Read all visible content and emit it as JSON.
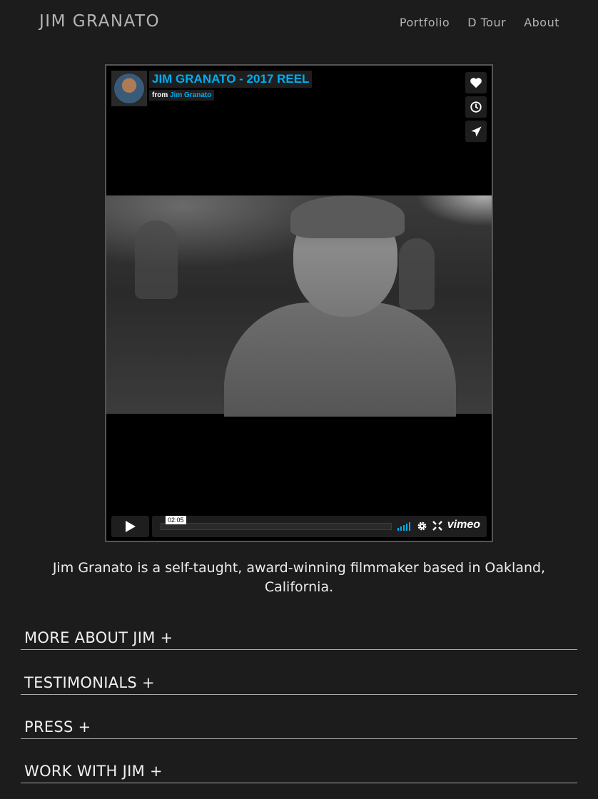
{
  "header": {
    "site_title": "JIM GRANATO",
    "nav": [
      {
        "label": "Portfolio"
      },
      {
        "label": "D Tour"
      },
      {
        "label": "About"
      }
    ]
  },
  "video": {
    "title": "JIM GRANATO - 2017 REEL",
    "byline_prefix": "from",
    "author": "Jim Granato",
    "timecode": "02:05",
    "brand": "vimeo",
    "accent_color": "#00adef",
    "side_actions": [
      {
        "icon": "heart-icon"
      },
      {
        "icon": "clock-icon"
      },
      {
        "icon": "send-icon"
      }
    ]
  },
  "bio": {
    "line1": "Jim Granato is a self-taught, award-winning filmmaker based in Oakland,",
    "line2": "California."
  },
  "sections": [
    {
      "label": "MORE ABOUT JIM +"
    },
    {
      "label": "TESTIMONIALS +"
    },
    {
      "label": "PRESS +"
    },
    {
      "label": "WORK WITH JIM +"
    }
  ]
}
